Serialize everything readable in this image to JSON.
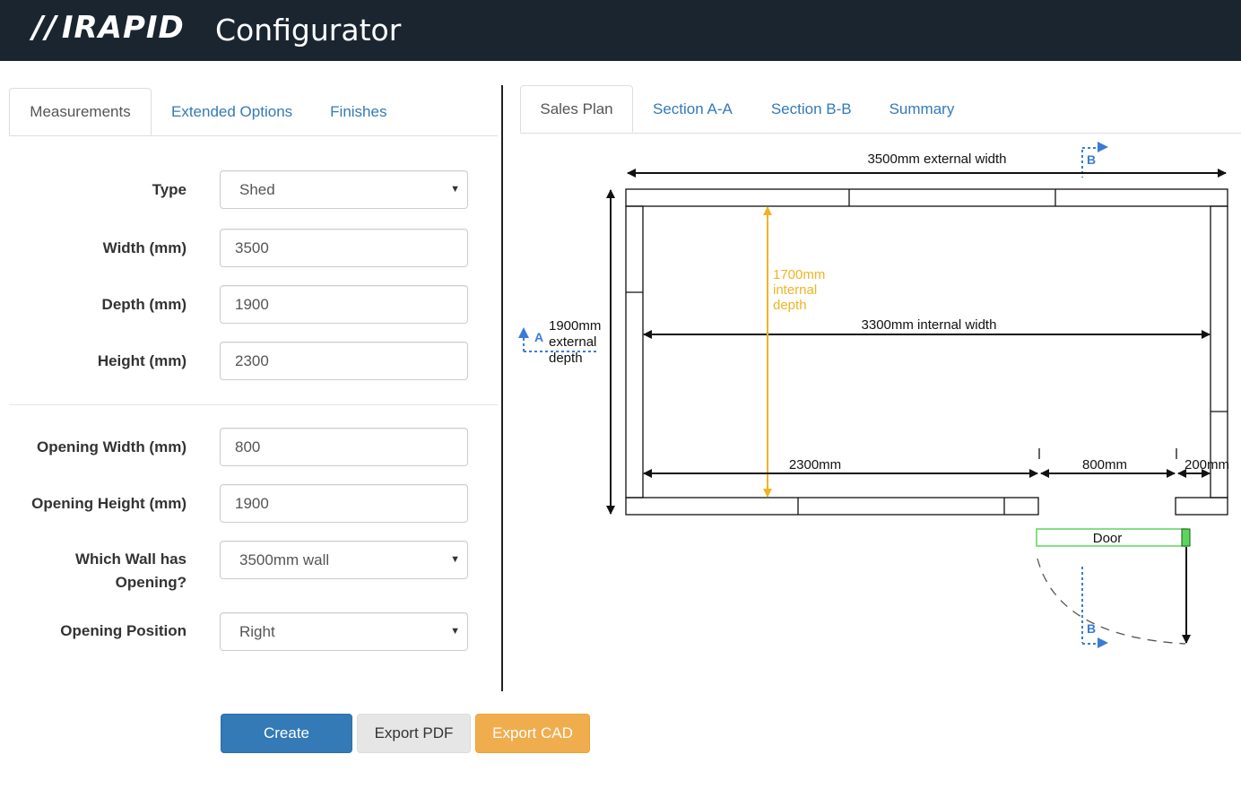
{
  "header": {
    "logo_slashes": "//",
    "logo_text": "IRAPID",
    "title": "Configurator"
  },
  "left_tabs": [
    "Measurements",
    "Extended Options",
    "Finishes"
  ],
  "right_tabs": [
    "Sales Plan",
    "Section A-A",
    "Section B-B",
    "Summary"
  ],
  "form": {
    "type": {
      "label": "Type",
      "value": "Shed"
    },
    "width": {
      "label": "Width (mm)",
      "value": "3500"
    },
    "depth": {
      "label": "Depth (mm)",
      "value": "1900"
    },
    "height": {
      "label": "Height (mm)",
      "value": "2300"
    },
    "opening_width": {
      "label": "Opening Width (mm)",
      "value": "800"
    },
    "opening_height": {
      "label": "Opening Height (mm)",
      "value": "1900"
    },
    "opening_wall": {
      "label_line1": "Which Wall has",
      "label_line2": "Opening?",
      "value": "3500mm wall"
    },
    "opening_position": {
      "label": "Opening Position",
      "value": "Right"
    }
  },
  "buttons": {
    "create": "Create",
    "export_pdf": "Export PDF",
    "export_cad": "Export CAD"
  },
  "plan": {
    "external_width": "3500mm external width",
    "external_depth": [
      "1900mm",
      "external",
      "depth"
    ],
    "internal_depth": [
      "1700mm",
      "internal",
      "depth"
    ],
    "internal_width": "3300mm internal width",
    "left_segment": "2300mm",
    "opening_segment": "800mm",
    "right_segment": "200mm",
    "door_label": "Door",
    "section_a": "A",
    "section_b": "B"
  },
  "colors": {
    "header_bg": "#1b2530",
    "primary": "#337ab7",
    "warning": "#f0ad4e",
    "dimension_yellow": "#f0b323",
    "section_blue": "#3a7bd5",
    "door_green": "#5ad65a"
  }
}
